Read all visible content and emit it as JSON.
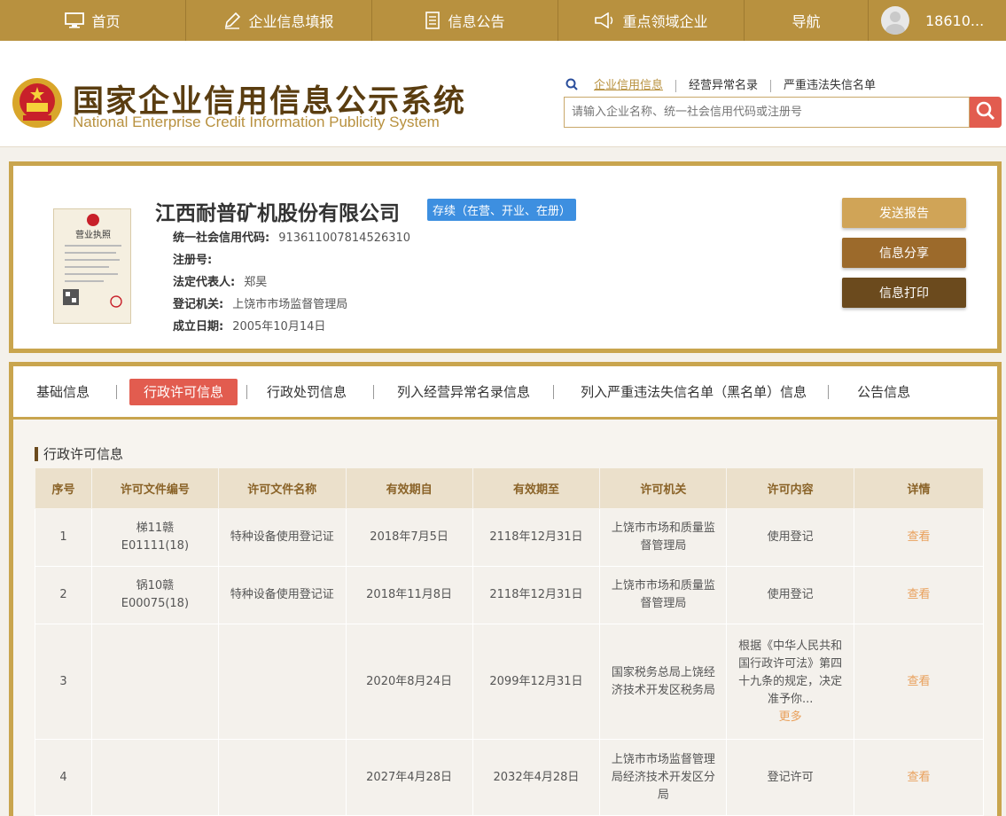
{
  "topnav": {
    "home": "首页",
    "fill": "企业信息填报",
    "notice": "信息公告",
    "key": "重点领域企业",
    "guide": "导航",
    "user": "18610..."
  },
  "header": {
    "title": "国家企业信用信息公示系统",
    "subtitle": "National Enterprise Credit Information Publicity System",
    "links": [
      "企业信用信息",
      "经营异常名录",
      "严重违法失信名单"
    ],
    "search_placeholder": "请输入企业名称、统一社会信用代码或注册号"
  },
  "company": {
    "name": "江西耐普矿机股份有限公司",
    "status": "存续（在营、开业、在册）",
    "fields": [
      {
        "label": "统一社会信用代码:",
        "value": "913611007814526310"
      },
      {
        "label": "注册号:",
        "value": ""
      },
      {
        "label": "法定代表人:",
        "value": "郑昊"
      },
      {
        "label": "登记机关:",
        "value": "上饶市市场监督管理局"
      },
      {
        "label": "成立日期:",
        "value": "2005年10月14日"
      }
    ],
    "license_caption": "营业执照",
    "buttons": {
      "send": "发送报告",
      "share": "信息分享",
      "print": "信息打印"
    }
  },
  "tabs": [
    "基础信息",
    "行政许可信息",
    "行政处罚信息",
    "列入经营异常名录信息",
    "列入严重违法失信名单（黑名单）信息",
    "公告信息"
  ],
  "section_title": "行政许可信息",
  "table": {
    "headers": [
      "序号",
      "许可文件编号",
      "许可文件名称",
      "有效期自",
      "有效期至",
      "许可机关",
      "许可内容",
      "详情"
    ],
    "rows": [
      {
        "no": "1",
        "code": "梯11赣E01111(18)",
        "name": "特种设备使用登记证",
        "from": "2018年7月5日",
        "to": "2118年12月31日",
        "org": "上饶市市场和质量监督管理局",
        "content": "使用登记",
        "detail": "查看"
      },
      {
        "no": "2",
        "code": "锅10赣E00075(18)",
        "name": "特种设备使用登记证",
        "from": "2018年11月8日",
        "to": "2118年12月31日",
        "org": "上饶市市场和质量监督管理局",
        "content": "使用登记",
        "detail": "查看"
      },
      {
        "no": "3",
        "code": "",
        "name": "",
        "from": "2020年8月24日",
        "to": "2099年12月31日",
        "org": "国家税务总局上饶经济技术开发区税务局",
        "content": "根据《中华人民共和国行政许可法》第四十九条的规定，决定准予你...",
        "more": "更多",
        "detail": "查看"
      },
      {
        "no": "4",
        "code": "",
        "name": "",
        "from": "2027年4月28日",
        "to": "2032年4月28日",
        "org": "上饶市市场监督管理局经济技术开发区分局",
        "content": "登记许可",
        "detail": "查看"
      }
    ]
  },
  "colors": {
    "gold": "#b8913f",
    "accent_red": "#e25c4f",
    "status_blue": "#3d8fe0",
    "link_orange": "#e9a05b"
  }
}
